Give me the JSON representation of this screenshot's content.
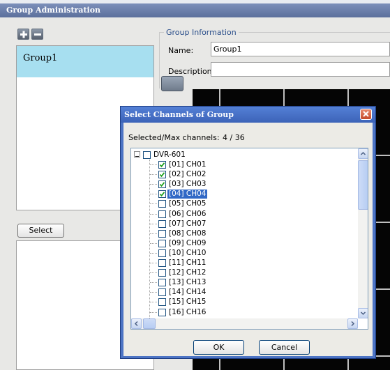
{
  "window": {
    "title": "Group Administration"
  },
  "groups": {
    "items": [
      "Group1"
    ]
  },
  "buttons": {
    "select": "Select"
  },
  "group_info": {
    "legend": "Group Information",
    "name_label": "Name:",
    "name_value": "Group1",
    "description_label": "Description:",
    "description_value": ""
  },
  "dialog": {
    "title": "Select Channels of Group",
    "selected_label": "Selected/Max channels:",
    "selected_value": "4 / 36",
    "root": {
      "label": "DVR-601",
      "checked": false
    },
    "channels": [
      {
        "label": "[01] CH01",
        "checked": true
      },
      {
        "label": "[02] CH02",
        "checked": true
      },
      {
        "label": "[03] CH03",
        "checked": true
      },
      {
        "label": "[04] CH04",
        "checked": true,
        "selected": true
      },
      {
        "label": "[05] CH05",
        "checked": false
      },
      {
        "label": "[06] CH06",
        "checked": false
      },
      {
        "label": "[07] CH07",
        "checked": false
      },
      {
        "label": "[08] CH08",
        "checked": false
      },
      {
        "label": "[09] CH09",
        "checked": false
      },
      {
        "label": "[10] CH10",
        "checked": false
      },
      {
        "label": "[11] CH11",
        "checked": false
      },
      {
        "label": "[12] CH12",
        "checked": false
      },
      {
        "label": "[13] CH13",
        "checked": false
      },
      {
        "label": "[14] CH14",
        "checked": false
      },
      {
        "label": "[15] CH15",
        "checked": false
      },
      {
        "label": "[16] CH16",
        "checked": false
      }
    ],
    "ok_label": "OK",
    "cancel_label": "Cancel"
  },
  "colors": {
    "accent": "#3c63b8",
    "selection": "#3169c6",
    "group_highlight": "#a7dff0"
  }
}
